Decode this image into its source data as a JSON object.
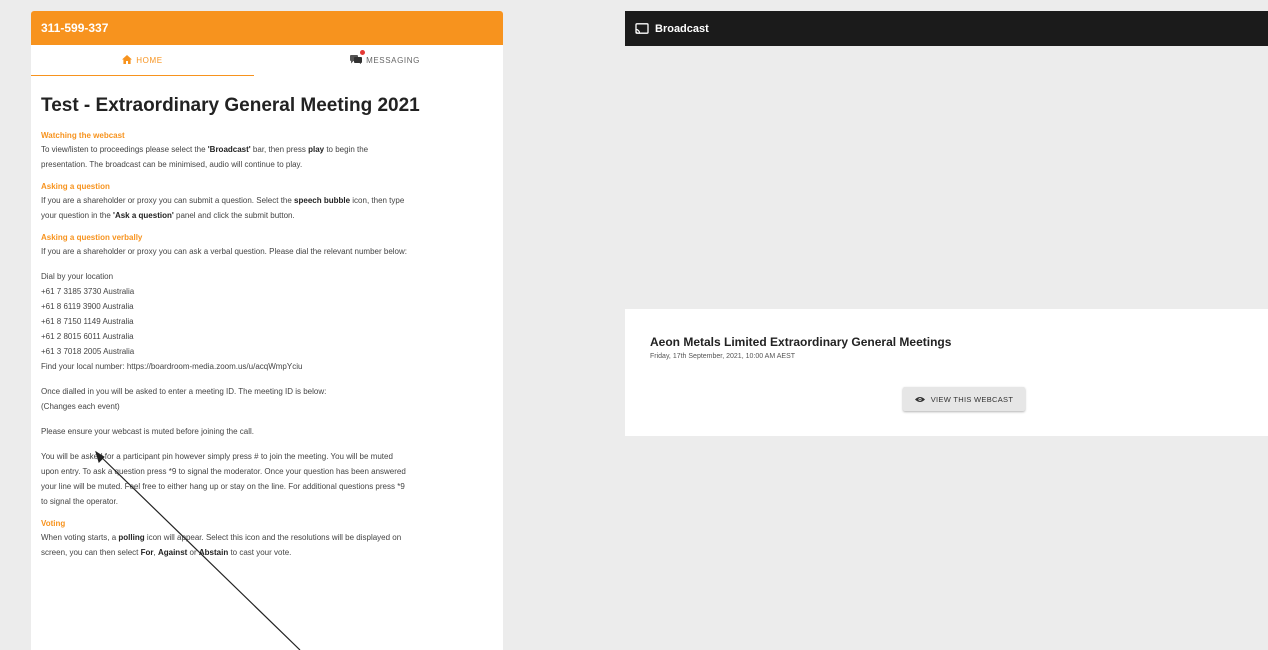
{
  "left_panel": {
    "header_id": "311-599-337",
    "tabs": [
      {
        "label": "HOME"
      },
      {
        "label": "MESSAGING"
      }
    ],
    "title": "Test - Extraordinary General Meeting 2021",
    "sections": [
      {
        "heading": "Watching the webcast",
        "text": [
          [
            "To view/listen to proceedings please select the ",
            "'Broadcast'",
            " bar, then press ",
            "play",
            " to begin the"
          ],
          [
            "presentation. The broadcast can be minimised, audio will continue to play."
          ]
        ]
      },
      {
        "heading": "Asking a question",
        "text": [
          [
            "If you are a shareholder or proxy you can submit a question. Select the ",
            "speech bubble",
            " icon, then type"
          ],
          [
            "your question in the ",
            "'Ask a question'",
            " panel and click the submit button."
          ]
        ]
      },
      {
        "heading": "Asking a question verbally",
        "text": [
          [
            "If you are a shareholder or proxy you can ask a verbal question. Please dial the relevant number below:"
          ]
        ]
      }
    ],
    "dial_block": {
      "intro": "Dial by your location",
      "numbers": [
        "+61 7 3185 3730 Australia",
        "+61 8 6119 3900 Australia",
        "+61 8 7150 1149 Australia",
        "+61 2 8015 6011 Australia",
        "+61 3 7018 2005 Australia"
      ],
      "local": "Find your local number: https://boardroom-media.zoom.us/u/acqWmpYciu"
    },
    "meeting_id": [
      "Once dialled in you will be asked to enter a meeting ID. The meeting ID is below:",
      "(Changes each event)"
    ],
    "mute_note": "Please ensure your webcast is muted before joining the call.",
    "pin_note": [
      "You will be asked for a participant pin however simply press # to join the meeting. You will be muted",
      "upon entry. To ask a question press *9 to signal the moderator. Once your question has been answered",
      "your line will be muted. Feel free to either hang up or stay on the line. For additional questions press *9",
      "to signal the operator."
    ],
    "voting": {
      "heading": "Voting",
      "text": [
        [
          "When voting starts, a ",
          "polling",
          " icon will appear. Select this icon and the resolutions will be displayed on"
        ],
        [
          "screen, you can then select ",
          "For",
          ", ",
          "Against",
          " or ",
          "Abstain",
          " to cast your vote."
        ]
      ]
    }
  },
  "right_panel": {
    "header_label": "Broadcast",
    "event_title": "Aeon Metals Limited Extraordinary General Meetings",
    "event_date": "Friday, 17th September, 2021, 10:00 AM AEST",
    "button_label": "VIEW THIS WEBCAST"
  },
  "icons": {
    "home": "home-icon",
    "messaging": "chat-bubbles-icon",
    "broadcast": "cast-icon",
    "view": "eye-icon"
  },
  "colors": {
    "accent": "#f7931e",
    "broadcast_bar": "#1b1b1b",
    "notification_dot": "#e53935"
  }
}
